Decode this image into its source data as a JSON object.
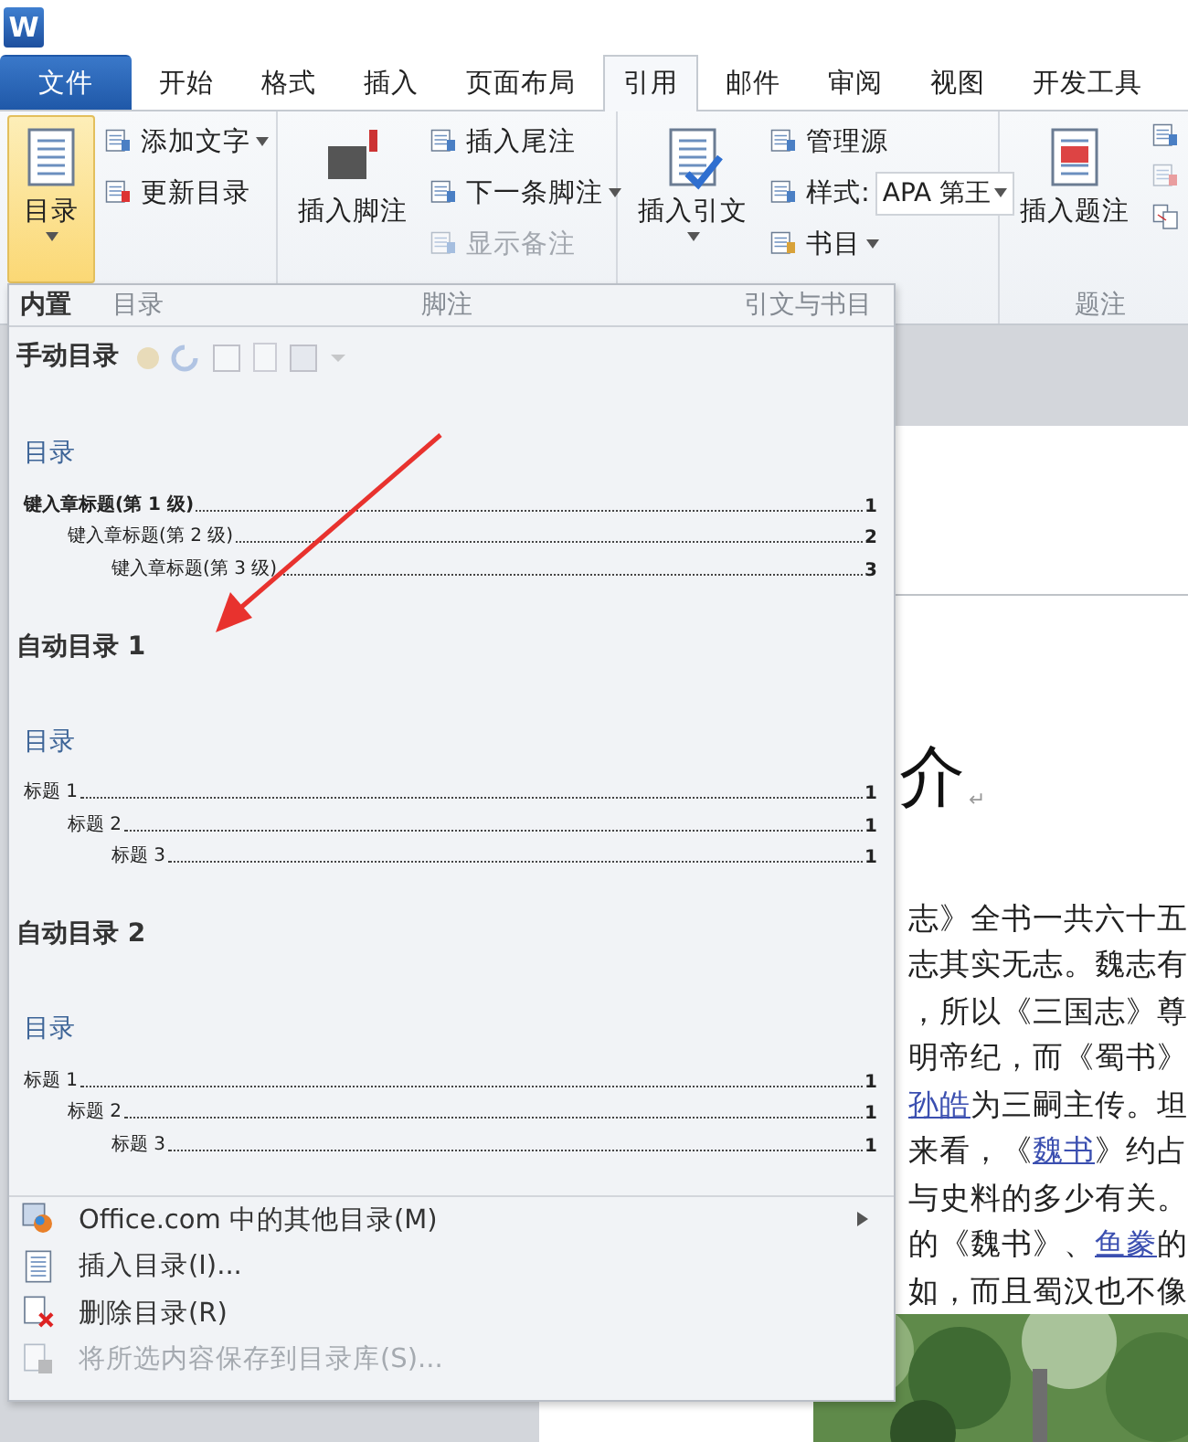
{
  "app_logo": "W",
  "ribbon_tabs": [
    {
      "label": "文件",
      "kind": "file",
      "selected": false
    },
    {
      "label": "开始",
      "kind": "tab",
      "selected": false
    },
    {
      "label": "格式",
      "kind": "tab",
      "selected": false
    },
    {
      "label": "插入",
      "kind": "tab",
      "selected": false
    },
    {
      "label": "页面布局",
      "kind": "tab",
      "selected": false
    },
    {
      "label": "引用",
      "kind": "tab",
      "selected": true
    },
    {
      "label": "邮件",
      "kind": "tab",
      "selected": false
    },
    {
      "label": "审阅",
      "kind": "tab",
      "selected": false
    },
    {
      "label": "视图",
      "kind": "tab",
      "selected": false
    },
    {
      "label": "开发工具",
      "kind": "tab",
      "selected": false
    }
  ],
  "ribbon_groups": [
    {
      "label": "目录",
      "large": {
        "label": "目录",
        "pressed": true,
        "dropdown": true
      },
      "small": [
        {
          "label": "添加文字",
          "dropdown": true,
          "disabled": false
        },
        {
          "label": "更新目录",
          "dropdown": false,
          "disabled": false
        }
      ]
    },
    {
      "label": "脚注",
      "large": {
        "label": "插入脚注",
        "pressed": false,
        "dropdown": false
      },
      "small": [
        {
          "label": "插入尾注",
          "dropdown": false,
          "disabled": false
        },
        {
          "label": "下一条脚注",
          "dropdown": true,
          "disabled": false
        },
        {
          "label": "显示备注",
          "dropdown": false,
          "disabled": true
        }
      ]
    },
    {
      "label": "引文与书目",
      "large": {
        "label": "插入引文",
        "pressed": false,
        "dropdown": true
      },
      "small": [
        {
          "label": "管理源",
          "dropdown": false,
          "disabled": false
        },
        {
          "label": "样式:",
          "dropdown": false,
          "disabled": false,
          "value": "APA 第王"
        },
        {
          "label": "书目",
          "dropdown": true,
          "disabled": false
        }
      ]
    },
    {
      "label": "题注",
      "large": {
        "label": "插入题注",
        "pressed": false,
        "dropdown": false
      }
    }
  ],
  "toc_menu": {
    "header": "内置",
    "galleries": [
      {
        "title": "手动目录",
        "preview": {
          "heading": "目录",
          "entries": [
            {
              "text": "键入章标题(第 1 级)",
              "page": "1",
              "bold": true,
              "children": [
                {
                  "text": "键入章标题(第 2 级)",
                  "page": "2",
                  "bold": false,
                  "children": [
                    {
                      "text": "键入章标题(第 3 级)",
                      "page": "3",
                      "bold": false
                    }
                  ]
                }
              ]
            }
          ]
        }
      },
      {
        "title": "自动目录 1",
        "preview": {
          "heading": "目录",
          "entries": [
            {
              "text": "标题 1",
              "page": "1",
              "bold": false,
              "children": [
                {
                  "text": "标题 2",
                  "page": "1",
                  "bold": false,
                  "children": [
                    {
                      "text": "标题 3",
                      "page": "1",
                      "bold": false
                    }
                  ]
                }
              ]
            }
          ]
        }
      },
      {
        "title": "自动目录 2",
        "preview": {
          "heading": "目录",
          "entries": [
            {
              "text": "标题 1",
              "page": "1",
              "bold": false,
              "children": [
                {
                  "text": "标题 2",
                  "page": "1",
                  "bold": false,
                  "children": [
                    {
                      "text": "标题 3",
                      "page": "1",
                      "bold": false
                    }
                  ]
                }
              ]
            }
          ]
        }
      }
    ],
    "commands": [
      {
        "label": "Office.com 中的其他目录(M)",
        "disabled": false,
        "submenu": true
      },
      {
        "label": "插入目录(I)...",
        "disabled": false,
        "submenu": false
      },
      {
        "label": "删除目录(R)",
        "disabled": false,
        "submenu": false
      },
      {
        "label": "将所选内容保存到目录库(S)...",
        "disabled": true,
        "submenu": false
      }
    ]
  },
  "document": {
    "heading": "介",
    "heading_mark": "↵",
    "lines": [
      [
        {
          "text": "志》全书一共六十五",
          "link": false
        }
      ],
      [
        {
          "text": "志其实无志。魏志有",
          "link": false
        }
      ],
      [
        {
          "text": "，所以《三国志》尊",
          "link": false
        }
      ],
      [
        {
          "text": "明帝纪，而《蜀书》",
          "link": false
        }
      ],
      [
        {
          "text": "孙皓",
          "link": true
        },
        {
          "text": "为三嗣主传。坦",
          "link": false
        }
      ],
      [
        {
          "text": "来看，《",
          "link": false
        },
        {
          "text": "魏书",
          "link": true
        },
        {
          "text": "》约占",
          "link": false
        }
      ],
      [
        {
          "text": "与史料的多少有关。",
          "link": false
        }
      ],
      [
        {
          "text": "的《魏书》、",
          "link": false
        },
        {
          "text": "鱼豢",
          "link": true
        },
        {
          "text": "的",
          "link": false
        }
      ],
      [
        {
          "text": "如，而且蜀汉也不像",
          "link": false
        }
      ]
    ],
    "picture": {
      "kind": "picture"
    }
  }
}
